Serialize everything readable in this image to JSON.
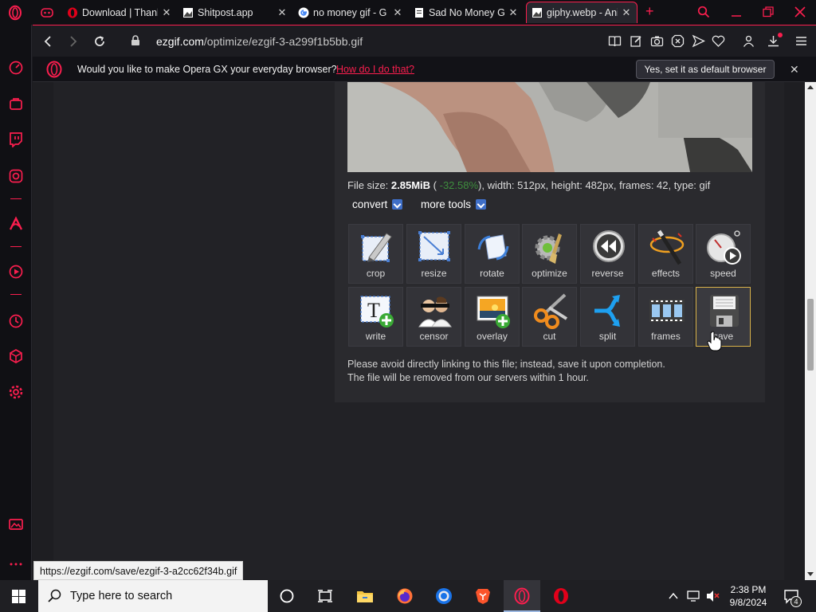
{
  "tabs": [
    {
      "title": "Download | Thank",
      "icon": "opera-icon",
      "close": "✕"
    },
    {
      "title": "Shitpost.app",
      "icon": "image-icon",
      "close": "✕"
    },
    {
      "title": "no money gif - G",
      "icon": "google-icon",
      "close": "✕"
    },
    {
      "title": "Sad No Money G",
      "icon": "document-icon",
      "close": "✕"
    },
    {
      "title": "giphy.webp - Ani",
      "icon": "image-icon",
      "close": "✕"
    }
  ],
  "new_tab": "+",
  "address": {
    "domain": "ezgif.com",
    "path": "/optimize/ezgif-3-a299f1b5bb.gif"
  },
  "notification": {
    "text": "Would you like to make Opera GX your everyday browser?",
    "link": "How do I do that?",
    "button": "Yes, set it as default browser",
    "close": "✕"
  },
  "file_info": {
    "label": "File size: ",
    "size": "2.85MiB",
    "paren_open": " ( ",
    "saved": "-32.58%",
    "rest": "), width: 512px, height: 482px, frames: 42, type: gif"
  },
  "menus": {
    "convert": "convert",
    "more_tools": "more tools"
  },
  "tools": [
    {
      "label": "crop"
    },
    {
      "label": "resize"
    },
    {
      "label": "rotate"
    },
    {
      "label": "optimize"
    },
    {
      "label": "reverse"
    },
    {
      "label": "effects"
    },
    {
      "label": "speed"
    },
    {
      "label": "write"
    },
    {
      "label": "censor"
    },
    {
      "label": "overlay"
    },
    {
      "label": "cut"
    },
    {
      "label": "split"
    },
    {
      "label": "frames"
    },
    {
      "label": "save"
    }
  ],
  "notice": {
    "line1": "Please avoid directly linking to this file; instead, save it upon completion.",
    "line2": "The file will be removed from our servers within 1 hour."
  },
  "status_url": "https://ezgif.com/save/ezgif-3-a2cc62f34b.gif",
  "taskbar": {
    "search_placeholder": "Type here to search",
    "time": "2:38 PM",
    "date": "9/8/2024",
    "notif_count": "4"
  },
  "colors": {
    "accent": "#fa1e4e",
    "link_saved": "#3e8e3e",
    "highlight": "#d9b24a"
  }
}
